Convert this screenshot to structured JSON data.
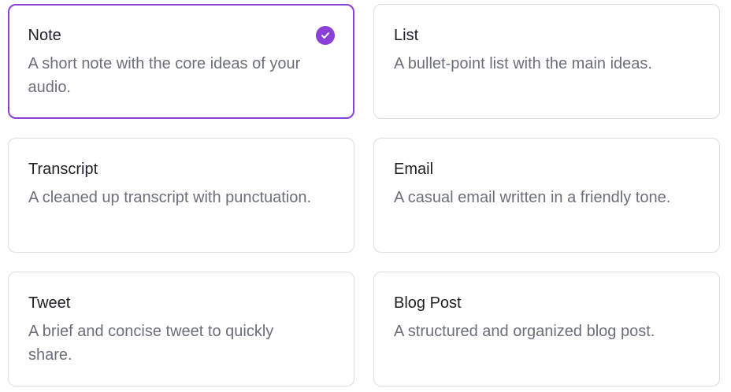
{
  "options": [
    {
      "title": "Note",
      "description": "A short note with the core ideas of your audio.",
      "selected": true
    },
    {
      "title": "List",
      "description": "A bullet-point list with the main ideas.",
      "selected": false
    },
    {
      "title": "Transcript",
      "description": "A cleaned up transcript with punctuation.",
      "selected": false
    },
    {
      "title": "Email",
      "description": "A casual email written in a friendly tone.",
      "selected": false
    },
    {
      "title": "Tweet",
      "description": "A brief and concise tweet to quickly share.",
      "selected": false
    },
    {
      "title": "Blog Post",
      "description": "A structured and organized blog post.",
      "selected": false
    }
  ],
  "colors": {
    "accent": "#8a3fd6",
    "title_text": "#1f2024",
    "description_text": "#6b6f78",
    "card_border": "#dcdde1"
  },
  "icons": {
    "selected": "check-circle-icon"
  }
}
